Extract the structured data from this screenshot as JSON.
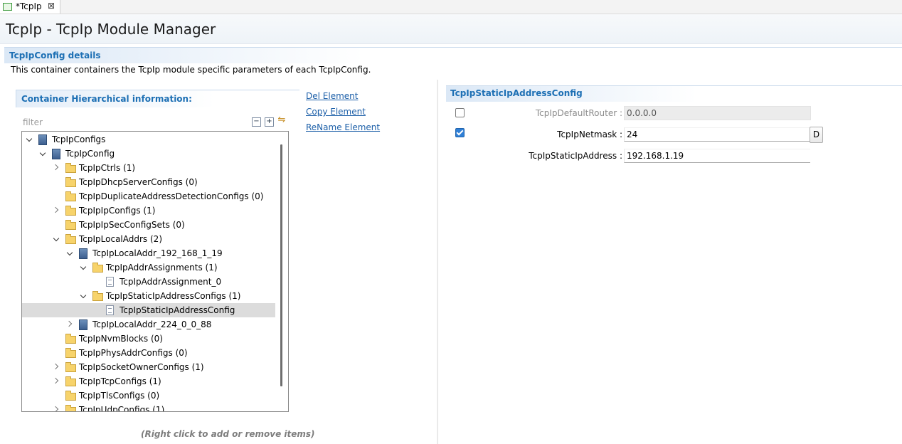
{
  "tab": {
    "title": "*TcpIp",
    "close_glyph": "⊠"
  },
  "header": {
    "title": "TcpIp - TcpIp Module Manager"
  },
  "section": {
    "title": "TcpIpConfig details",
    "description": "This container containers the TcpIp module specific parameters of each TcpIpConfig."
  },
  "left_panel": {
    "title": "Container Hierarchical information:",
    "filter_placeholder": "filter",
    "hint": "(Right click to add or remove items)"
  },
  "actions": {
    "del": "Del Element",
    "copy": "Copy Element",
    "rename": "ReName Element"
  },
  "tree": [
    {
      "label": "TcpIpConfigs",
      "twisty": "open",
      "icon": "container-icon",
      "level": 0
    },
    {
      "label": "TcpIpConfig",
      "twisty": "open",
      "icon": "container-icon",
      "level": 1
    },
    {
      "label": "TcpIpCtrls (1)",
      "twisty": "closed",
      "icon": "folder-icon",
      "level": 2
    },
    {
      "label": "TcpIpDhcpServerConfigs (0)",
      "twisty": "none",
      "icon": "folder-icon",
      "level": 2
    },
    {
      "label": "TcpIpDuplicateAddressDetectionConfigs (0)",
      "twisty": "none",
      "icon": "folder-icon",
      "level": 2
    },
    {
      "label": "TcpIpIpConfigs (1)",
      "twisty": "closed",
      "icon": "folder-icon",
      "level": 2
    },
    {
      "label": "TcpIpIpSecConfigSets (0)",
      "twisty": "none",
      "icon": "folder-icon",
      "level": 2
    },
    {
      "label": "TcpIpLocalAddrs (2)",
      "twisty": "open",
      "icon": "folder-icon",
      "level": 2
    },
    {
      "label": "TcpIpLocalAddr_192_168_1_19",
      "twisty": "open",
      "icon": "container-icon",
      "level": 3
    },
    {
      "label": "TcpIpAddrAssignments (1)",
      "twisty": "open",
      "icon": "folder-icon",
      "level": 4
    },
    {
      "label": "TcpIpAddrAssignment_0",
      "twisty": "none",
      "icon": "file-icon",
      "level": 5
    },
    {
      "label": "TcpIpStaticIpAddressConfigs (1)",
      "twisty": "open",
      "icon": "folder-icon",
      "level": 4
    },
    {
      "label": "TcpIpStaticIpAddressConfig",
      "twisty": "none",
      "icon": "file-icon",
      "level": 5,
      "selected": true
    },
    {
      "label": "TcpIpLocalAddr_224_0_0_88",
      "twisty": "closed",
      "icon": "container-icon",
      "level": 3
    },
    {
      "label": "TcpIpNvmBlocks (0)",
      "twisty": "none",
      "icon": "folder-icon",
      "level": 2
    },
    {
      "label": "TcpIpPhysAddrConfigs (0)",
      "twisty": "none",
      "icon": "folder-icon",
      "level": 2
    },
    {
      "label": "TcpIpSocketOwnerConfigs (1)",
      "twisty": "closed",
      "icon": "folder-icon",
      "level": 2
    },
    {
      "label": "TcpIpTcpConfigs (1)",
      "twisty": "closed",
      "icon": "folder-icon",
      "level": 2
    },
    {
      "label": "TcpIpTlsConfigs (0)",
      "twisty": "none",
      "icon": "folder-icon",
      "level": 2
    },
    {
      "label": "TcpIpUdpConfigs (1)",
      "twisty": "closed",
      "icon": "folder-icon",
      "level": 2
    }
  ],
  "right_panel": {
    "title": "TcpIpStaticIpAddressConfig",
    "params": {
      "default_router": {
        "label": "TcpIpDefaultRouter :",
        "value": "0.0.0.0",
        "enabled": false
      },
      "netmask": {
        "label": "TcpIpNetmask :",
        "value": "24",
        "enabled": true,
        "default_button": "D"
      },
      "static_ip": {
        "label": "TcpIpStaticIpAddress :",
        "value": "192.168.1.19"
      }
    }
  },
  "colors": {
    "accent": "#1c6fb4",
    "link": "#1c5fa8",
    "selection": "#dcdcdc",
    "checkbox": "#2f7fd6"
  }
}
